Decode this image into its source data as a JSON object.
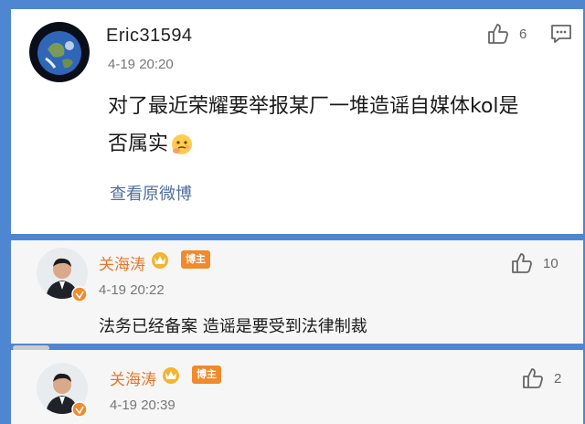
{
  "comment": {
    "username": "Eric31594",
    "timestamp": "4-19 20:20",
    "like_count": "6",
    "text_line1": "对了最近荣耀要举报某厂一堆造谣自媒体kol是",
    "text_line2": "否属实",
    "view_original": "查看原微博",
    "emoji_icon": "thinking-face-icon",
    "comment_icon": "comment-icon"
  },
  "reply1": {
    "username": "关海涛",
    "badge_label": "博主",
    "timestamp": "4-19 20:22",
    "like_count": "10",
    "text": "法务已经备案 造谣是要受到法律制裁"
  },
  "reply2": {
    "username": "关海涛",
    "badge_label": "博主",
    "timestamp": "4-19 20:39",
    "like_count": "2"
  },
  "colors": {
    "background": "#4f86d2",
    "username_orange": "#e8762a",
    "link": "#4f6f9f",
    "badge": "#f08a2c"
  }
}
